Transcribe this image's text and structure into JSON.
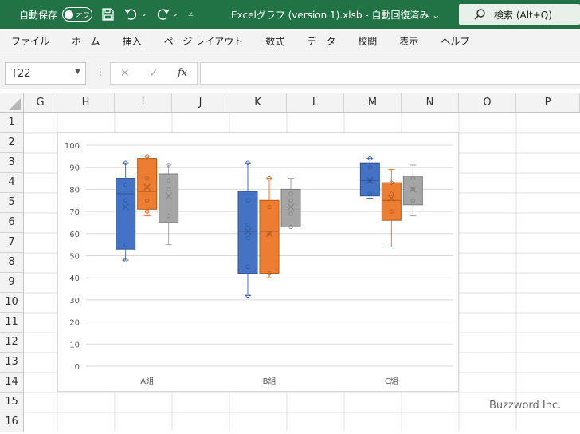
{
  "titlebar": {
    "autosave_label": "自動保存",
    "autosave_state": "オフ",
    "document_title": "Excelグラフ (version 1).xlsb  -  自動回復済み  ⌄",
    "search_label": "検索 (Alt+Q)"
  },
  "menubar": {
    "items": [
      "ファイル",
      "ホーム",
      "挿入",
      "ページ レイアウト",
      "数式",
      "データ",
      "校閲",
      "表示",
      "ヘルプ"
    ]
  },
  "formula_bar": {
    "name_box": "T22",
    "cancel_symbol": "✕",
    "enter_symbol": "✓",
    "fx_symbol": "fx",
    "formula": ""
  },
  "sheet": {
    "columns": [
      "G",
      "H",
      "I",
      "J",
      "K",
      "L",
      "M",
      "N",
      "O",
      "P"
    ],
    "rows": [
      "1",
      "2",
      "3",
      "4",
      "5",
      "6",
      "7",
      "8",
      "9",
      "10",
      "11",
      "12",
      "13",
      "14",
      "15",
      "16"
    ]
  },
  "chart_data": {
    "type": "box",
    "categories": [
      "A組",
      "B組",
      "C組"
    ],
    "ylim": [
      0,
      100
    ],
    "yticks": [
      0,
      10,
      20,
      30,
      40,
      50,
      60,
      70,
      80,
      90,
      100
    ],
    "grid": true,
    "series": [
      {
        "color": "#4472c4",
        "boxes": [
          {
            "min": 48,
            "q1": 53,
            "median": 78,
            "q3": 85,
            "max": 92,
            "mean": 72,
            "points": [
              55,
              75,
              82,
              92,
              48
            ]
          },
          {
            "min": 32,
            "q1": 42,
            "median": 61,
            "q3": 79,
            "max": 92,
            "mean": 61,
            "points": [
              45,
              58,
              64,
              75,
              92,
              32
            ]
          },
          {
            "min": 76,
            "q1": 77,
            "median": 84,
            "q3": 92,
            "max": 94,
            "mean": 84,
            "points": [
              78,
              84,
              90,
              94
            ]
          }
        ]
      },
      {
        "color": "#ed7d31",
        "boxes": [
          {
            "min": 68,
            "q1": 71,
            "median": 79,
            "q3": 94,
            "max": 95,
            "mean": 81,
            "points": [
              70,
              75,
              85,
              95
            ]
          },
          {
            "min": 40,
            "q1": 42,
            "median": 61,
            "q3": 75,
            "max": 85,
            "mean": 60,
            "points": [
              42,
              60,
              72,
              85
            ]
          },
          {
            "min": 54,
            "q1": 66,
            "median": 75,
            "q3": 83,
            "max": 89,
            "mean": 76,
            "points": [
              70,
              78,
              83
            ]
          }
        ]
      },
      {
        "color": "#a5a5a5",
        "boxes": [
          {
            "min": 55,
            "q1": 65,
            "median": 81,
            "q3": 87,
            "max": 91,
            "mean": 77,
            "points": [
              68,
              80,
              84,
              91
            ]
          },
          {
            "min": 63,
            "q1": 63,
            "median": 72,
            "q3": 80,
            "max": 85,
            "mean": 72,
            "points": [
              63,
              69,
              75,
              78
            ]
          },
          {
            "min": 68,
            "q1": 73,
            "median": 81,
            "q3": 86,
            "max": 91,
            "mean": 80,
            "points": [
              75,
              80,
              85
            ]
          }
        ]
      }
    ]
  },
  "watermark": "Buzzword Inc."
}
